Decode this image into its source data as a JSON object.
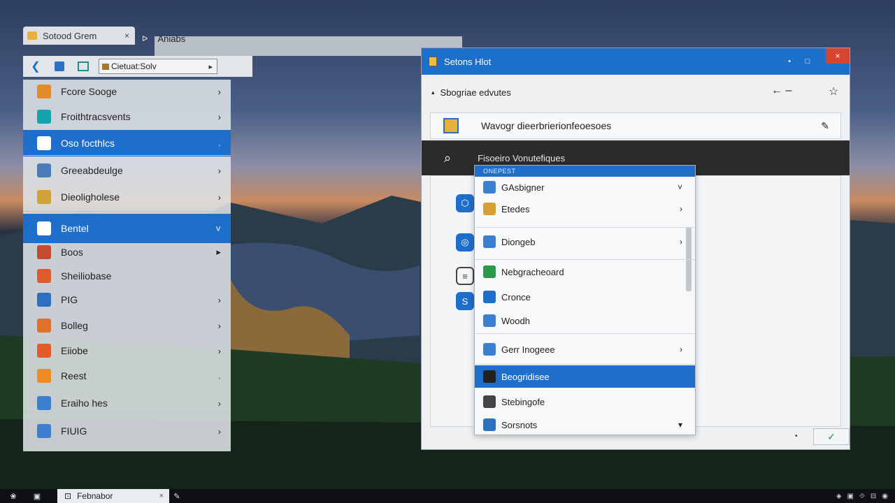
{
  "left_window": {
    "tab_label": "Sotood Grem",
    "tab_close": "×",
    "second_tab_label": "Aniabs",
    "address_text": "Cietuat:Solv",
    "address_go": "▸",
    "menu": [
      {
        "label": "Fcore Sooge",
        "icon": "folder-icon",
        "color": "#e38a2b",
        "chevron": "›",
        "selected": false
      },
      {
        "label": "Froithtracsvents",
        "icon": "monitor-icon",
        "color": "#16a3b0",
        "chevron": "›",
        "selected": false
      },
      {
        "label": "Oso focthlcs",
        "icon": "shield-icon",
        "color": "#ffffff",
        "chevron": "˒",
        "selected": true
      },
      {
        "label": "Greeabdeulge",
        "icon": "chart-icon",
        "color": "#4a7db8",
        "chevron": "›",
        "selected": false
      },
      {
        "label": "Dieoligholese",
        "icon": "edit-icon",
        "color": "#d0a23a",
        "chevron": "›",
        "selected": false
      },
      {
        "label": "Bentel",
        "icon": "page-icon",
        "color": "#5aa3e8",
        "chevron": "˅",
        "selected": true
      },
      {
        "label": "Boos",
        "icon": "camera-icon",
        "color": "#c44b2e",
        "chevron": "▸",
        "selected": false
      },
      {
        "label": "Sheiliobase",
        "icon": "warning-icon",
        "color": "#e05a2a",
        "chevron": "",
        "selected": false
      },
      {
        "label": "PIG",
        "icon": "shield-icon",
        "color": "#2f6fbf",
        "chevron": "›",
        "selected": false
      },
      {
        "label": "Bolleg",
        "icon": "archive-icon",
        "color": "#e0702a",
        "chevron": "›",
        "selected": false
      },
      {
        "label": "Eiiobe",
        "icon": "bug-icon",
        "color": "#e55a2a",
        "chevron": "›",
        "selected": false
      },
      {
        "label": "Reest",
        "icon": "gear-icon",
        "color": "#f08a22",
        "chevron": "˒",
        "selected": false
      },
      {
        "label": "Eraiho hes",
        "icon": "image-icon",
        "color": "#3c7fcf",
        "chevron": "›",
        "selected": false
      },
      {
        "label": "FIUIG",
        "icon": "grid-icon",
        "color": "#3c7fcf",
        "chevron": "›",
        "selected": false
      }
    ]
  },
  "right_window": {
    "title": "Setons Hlot",
    "minimize": "•",
    "maximize": "□",
    "close": "×",
    "cmd_label": "Sbogriae edvutes",
    "info_text": "Wavogr dieerbrierionfeoesoes",
    "search_text": "Fisoeiro Vonutefiques",
    "ok_label": "✓",
    "dot": "•"
  },
  "dropdown": {
    "header": "ONEPEST",
    "items": [
      {
        "label": "GAsbigner",
        "icon": "gear-icon",
        "color": "#3c7fcf",
        "chevron": "˅",
        "selected": false
      },
      {
        "label": "Etedes",
        "icon": "folder-icon",
        "color": "#d6a033",
        "chevron": "›",
        "selected": false
      },
      {
        "label": "Diongeb",
        "icon": "page-icon",
        "color": "#3c7fcf",
        "chevron": "›",
        "selected": false
      },
      {
        "label": "Nebgracheoard",
        "icon": "globe-icon",
        "color": "#2a9a4a",
        "chevron": "",
        "selected": false
      },
      {
        "label": "Cronce",
        "icon": "tablet-icon",
        "color": "#1e6ecb",
        "chevron": "",
        "selected": false
      },
      {
        "label": "Woodh",
        "icon": "check-icon",
        "color": "#3c7fcf",
        "chevron": "",
        "selected": false
      },
      {
        "label": "Gerr Inogeee",
        "icon": "info-icon",
        "color": "#3c7fcf",
        "chevron": "›",
        "selected": false
      },
      {
        "label": "Beogridisee",
        "icon": "terminal-icon",
        "color": "#222222",
        "chevron": "",
        "selected": true
      },
      {
        "label": "Stebingofe",
        "icon": "camera-icon",
        "color": "#444444",
        "chevron": "",
        "selected": false
      },
      {
        "label": "Sorsnots",
        "icon": "db-icon",
        "color": "#2f6fbf",
        "chevron": "▾",
        "selected": false
      }
    ]
  },
  "taskbar": {
    "item_label": "Febnabor",
    "item_close": "×"
  }
}
